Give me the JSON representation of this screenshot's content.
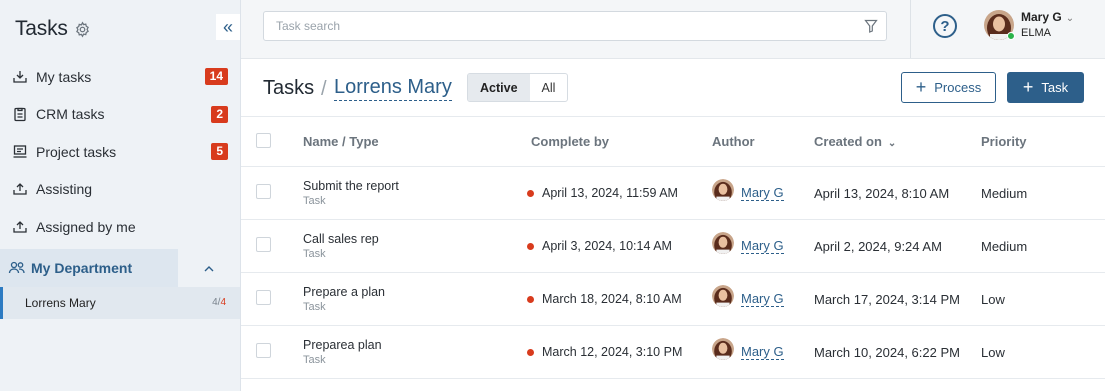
{
  "sidebar": {
    "title": "Tasks",
    "items": [
      {
        "label": "My tasks",
        "icon": "inbox-download-icon",
        "badge": "14"
      },
      {
        "label": "CRM tasks",
        "icon": "clipboard-icon",
        "badge": "2"
      },
      {
        "label": "Project tasks",
        "icon": "project-board-icon",
        "badge": "5"
      },
      {
        "label": "Assisting",
        "icon": "tray-up-icon",
        "badge": ""
      },
      {
        "label": "Assigned by me",
        "icon": "tray-export-icon",
        "badge": ""
      }
    ],
    "department": {
      "label": "My Department",
      "icon": "users-icon"
    },
    "sub_item": {
      "label": "Lorrens Mary",
      "count_done": "4",
      "count_total": "4"
    }
  },
  "topbar": {
    "search_placeholder": "Task search",
    "user": {
      "name": "Mary G",
      "org": "ELMA",
      "status_color": "#2bb34a"
    }
  },
  "page": {
    "crumb_root": "Tasks",
    "crumb_sep": "/",
    "crumb_current": "Lorrens Mary",
    "filters": [
      "Active",
      "All"
    ],
    "active_filter": "Active",
    "btn_process": "Process",
    "btn_task": "Task"
  },
  "table": {
    "headers": {
      "name": "Name / Type",
      "complete_by": "Complete by",
      "author": "Author",
      "created_on": "Created on",
      "priority": "Priority"
    },
    "rows": [
      {
        "name": "Submit the report",
        "type": "Task",
        "complete_by": "April 13, 2024, 11:59 AM",
        "author": "Mary G",
        "created_on": "April 13, 2024, 8:10 AM",
        "priority": "Medium"
      },
      {
        "name": "Call sales rep",
        "type": "Task",
        "complete_by": "April 3, 2024, 10:14 AM",
        "author": "Mary G",
        "created_on": "April 2, 2024, 9:24 AM",
        "priority": "Medium"
      },
      {
        "name": "Prepare a plan",
        "type": "Task",
        "complete_by": "March 18, 2024, 8:10 AM",
        "author": "Mary G",
        "created_on": "March 17, 2024, 3:14 PM",
        "priority": "Low"
      },
      {
        "name": "Preparea plan",
        "type": "Task",
        "complete_by": "March 12, 2024, 3:10 PM",
        "author": "Mary G",
        "created_on": "March 10, 2024, 6:22 PM",
        "priority": "Low"
      }
    ]
  },
  "colors": {
    "accent": "#2d5f8a",
    "badge": "#d83b1d",
    "overdue_dot": "#d83b1d"
  }
}
